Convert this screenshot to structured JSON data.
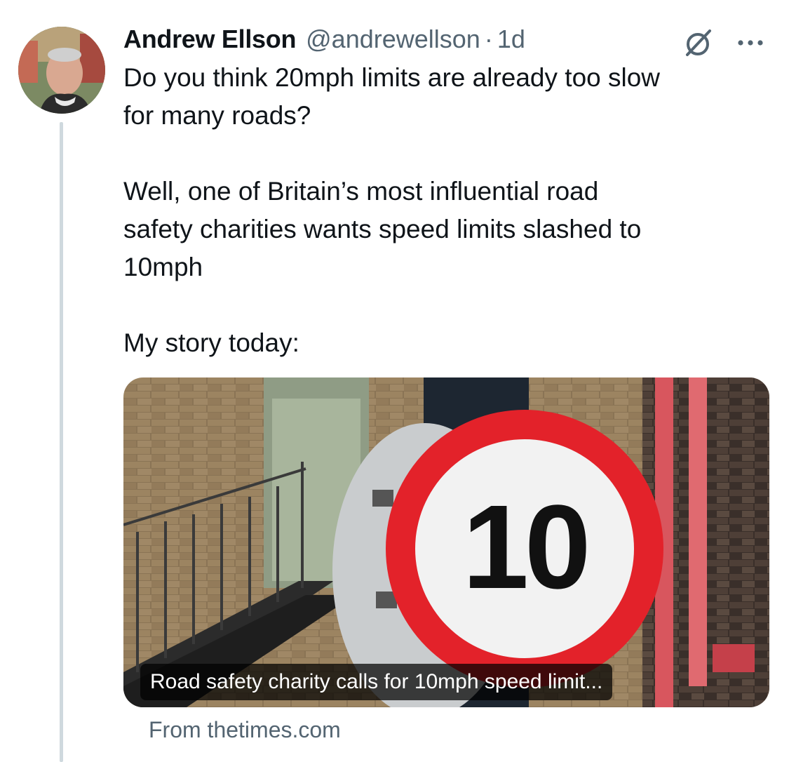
{
  "tweet": {
    "author_name": "Andrew Ellson",
    "handle": "@andrewellson",
    "separator": "·",
    "time": "1d",
    "text_lines": [
      "Do you think 20mph limits are already too slow",
      "for many roads?",
      "",
      "Well, one of Britain’s most influential road",
      "safety charities wants speed limits slashed to",
      "10mph",
      "",
      "My story today:"
    ]
  },
  "card": {
    "title": "Road safety charity calls for 10mph speed limit...",
    "source": "From thetimes.com",
    "sign_number": "10"
  },
  "icons": {
    "grok": "grok-slash-icon",
    "more": "more-dots-icon"
  },
  "colors": {
    "text_primary": "#0f1419",
    "text_secondary": "#536471",
    "thread_line": "#cfd9de",
    "sign_red": "#e3222a"
  }
}
